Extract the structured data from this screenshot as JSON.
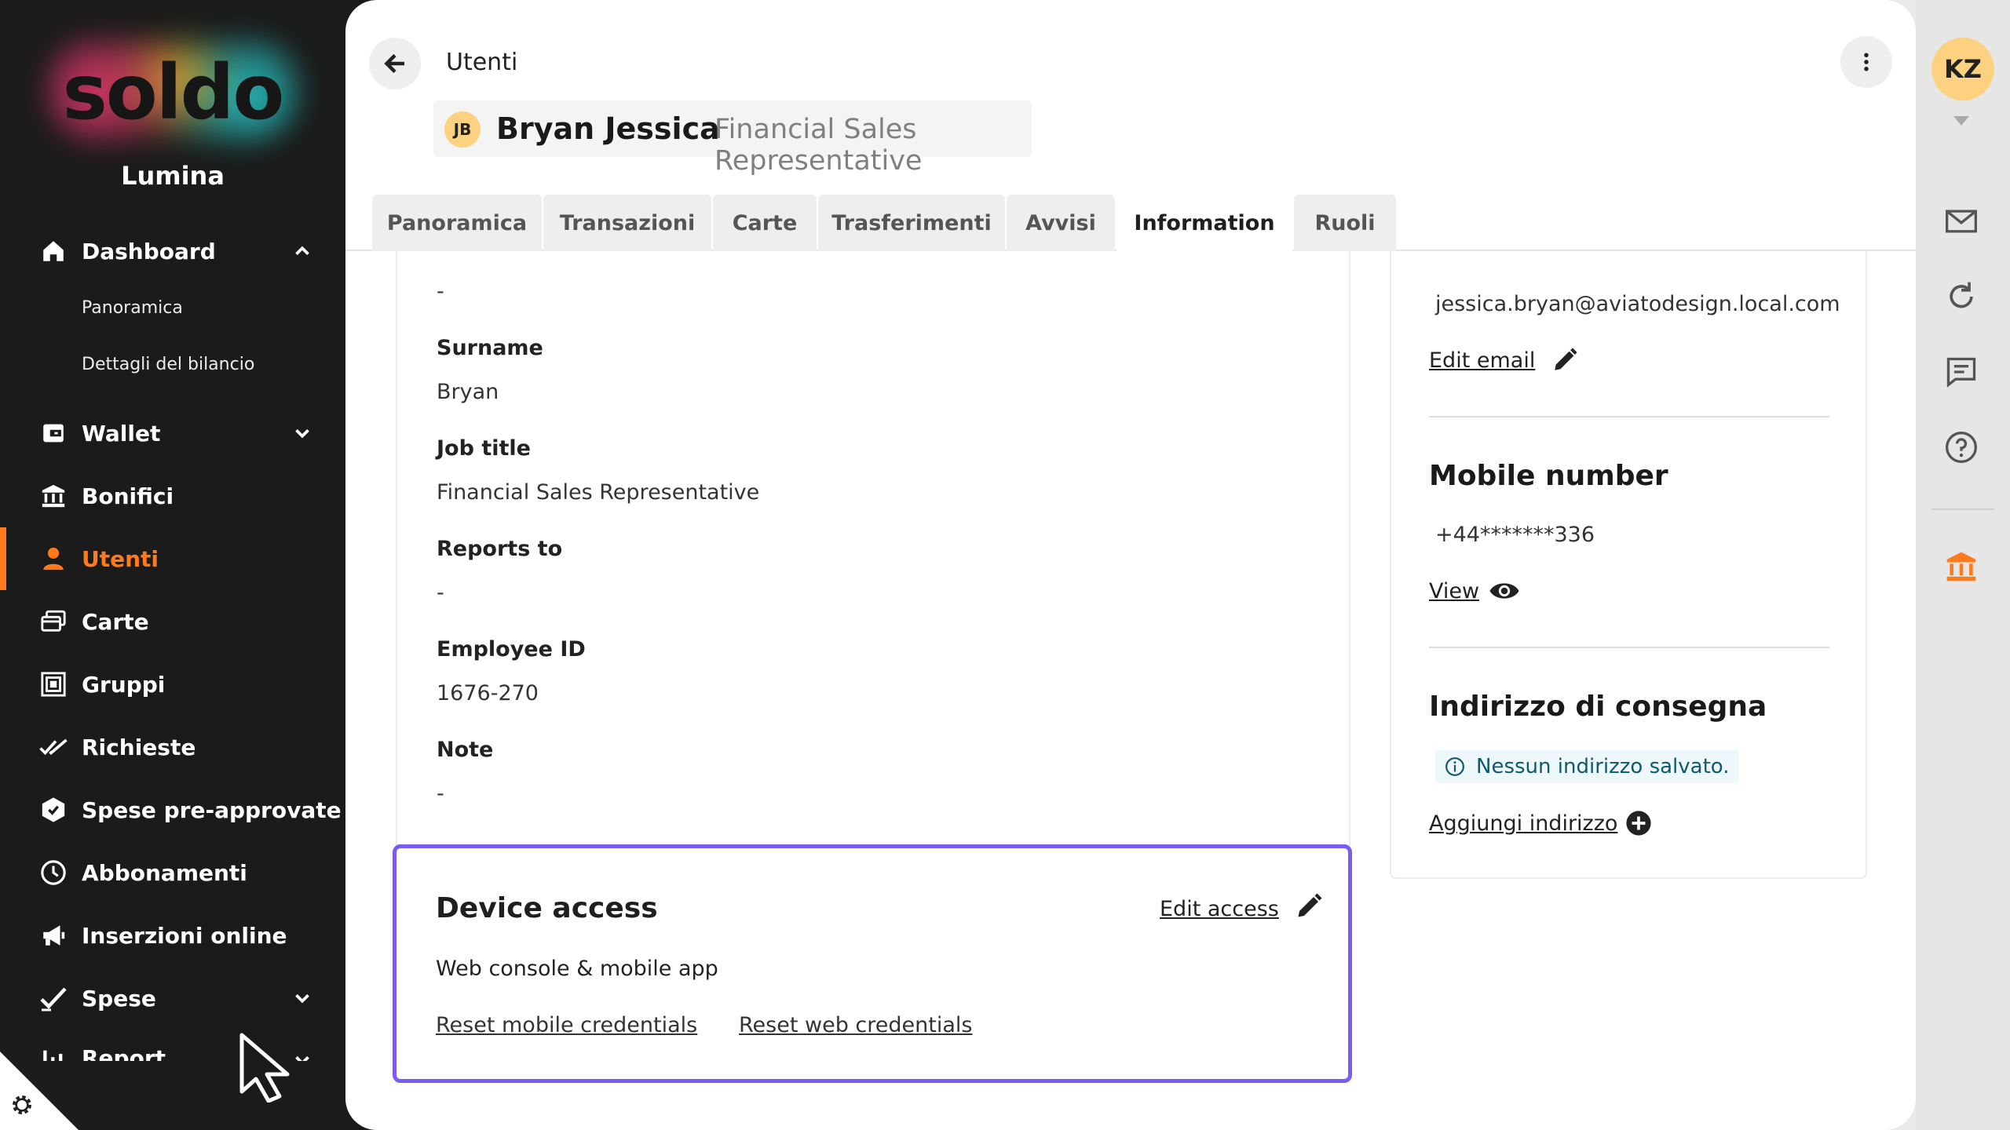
{
  "sidebar": {
    "logo": "soldo",
    "org_name": "Lumina",
    "nav": [
      {
        "id": "dashboard",
        "label": "Dashboard",
        "icon": "home-icon",
        "expanded": true
      },
      {
        "id": "wallet",
        "label": "Wallet",
        "icon": "wallet-icon"
      },
      {
        "id": "bonifici",
        "label": "Bonifici",
        "icon": "bank-transfer-icon"
      },
      {
        "id": "utenti",
        "label": "Utenti",
        "icon": "user-icon",
        "active": true
      },
      {
        "id": "carte",
        "label": "Carte",
        "icon": "cards-icon"
      },
      {
        "id": "gruppi",
        "label": "Gruppi",
        "icon": "groups-icon"
      },
      {
        "id": "richieste",
        "label": "Richieste",
        "icon": "double-check-icon"
      },
      {
        "id": "spese-pre",
        "label": "Spese pre-approvate",
        "icon": "hexagon-check-icon"
      },
      {
        "id": "abbonamenti",
        "label": "Abbonamenti",
        "icon": "clock-icon"
      },
      {
        "id": "inserzioni",
        "label": "Inserzioni online",
        "icon": "megaphone-icon"
      },
      {
        "id": "spese",
        "label": "Spese",
        "icon": "check-icon"
      },
      {
        "id": "report",
        "label": "Report",
        "icon": "bar-chart-icon"
      }
    ],
    "dashboard_sub": [
      "Panoramica",
      "Dettagli del bilancio"
    ]
  },
  "header": {
    "breadcrumb": "Utenti",
    "user_initials": "JB",
    "user_name": "Bryan Jessica",
    "user_role": "Financial Sales Representative"
  },
  "tabs": [
    "Panoramica",
    "Transazioni",
    "Carte",
    "Trasferimenti",
    "Avvisi",
    "Information",
    "Ruoli"
  ],
  "active_tab": "Information",
  "info": {
    "top_value": "-",
    "surname_label": "Surname",
    "surname_value": "Bryan",
    "job_title_label": "Job title",
    "job_title_value": "Financial Sales Representative",
    "reports_to_label": "Reports to",
    "reports_to_value": "-",
    "employee_id_label": "Employee ID",
    "employee_id_value": "1676-270",
    "note_label": "Note",
    "note_value": "-"
  },
  "device_access": {
    "title": "Device access",
    "edit_label": "Edit access",
    "description": "Web console & mobile app",
    "reset_mobile": "Reset mobile credentials",
    "reset_web": "Reset web credentials"
  },
  "contact": {
    "email": "jessica.bryan@aviatodesign.local.com",
    "edit_email": "Edit email",
    "mobile_title": "Mobile number",
    "mobile_value": "+44*******336",
    "view_label": "View",
    "address_title": "Indirizzo di consegna",
    "address_notice": "Nessun indirizzo salvato.",
    "add_address": "Aggiungi indirizzo"
  },
  "rail": {
    "initials": "KZ"
  },
  "colors": {
    "accent": "#ff7a1a",
    "highlight": "#7a5cf0",
    "avatar": "#fcd280",
    "sidebar_bg": "#1b1b1b"
  }
}
